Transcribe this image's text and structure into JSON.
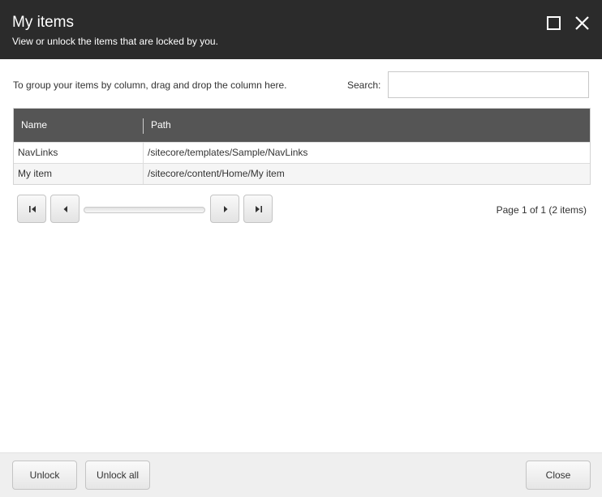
{
  "dialog": {
    "title": "My items",
    "subtitle": "View or unlock the items that are locked by you."
  },
  "titlebar_icons": {
    "maximize": "maximize-icon",
    "close": "close-icon"
  },
  "toolbar": {
    "group_hint": "To group your items by column, drag and drop the column here.",
    "search_label": "Search:",
    "search_value": "",
    "search_placeholder": ""
  },
  "grid": {
    "columns": [
      "Name",
      "Path"
    ],
    "rows": [
      {
        "name": "NavLinks",
        "path": "/sitecore/templates/Sample/NavLinks"
      },
      {
        "name": "My item",
        "path": "/sitecore/content/Home/My item"
      }
    ]
  },
  "pager": {
    "info": "Page 1 of 1 (2 items)",
    "icons": [
      "seek-first-icon",
      "seek-prev-icon",
      "seek-next-icon",
      "seek-last-icon"
    ]
  },
  "footer": {
    "unlock_label": "Unlock",
    "unlock_all_label": "Unlock all",
    "close_label": "Close"
  },
  "colors": {
    "titlebar": "#2b2b2b",
    "grid_header": "#555555",
    "footer": "#efefef"
  }
}
